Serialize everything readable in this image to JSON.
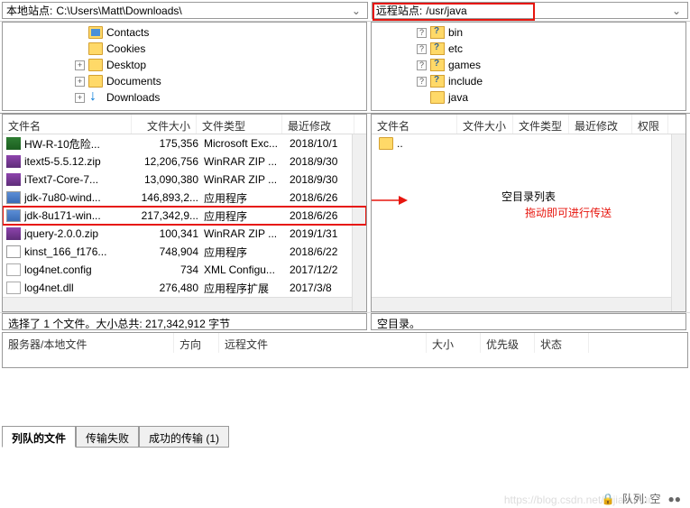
{
  "local": {
    "label": "本地站点:",
    "path": "C:\\Users\\Matt\\Downloads\\",
    "tree": [
      {
        "toggle": "",
        "icon": "contacts",
        "name": "Contacts"
      },
      {
        "toggle": "",
        "icon": "folder",
        "name": "Cookies"
      },
      {
        "toggle": "+",
        "icon": "folder",
        "name": "Desktop"
      },
      {
        "toggle": "+",
        "icon": "folder",
        "name": "Documents"
      },
      {
        "toggle": "+",
        "icon": "download",
        "name": "Downloads"
      }
    ],
    "headers": {
      "name": "文件名",
      "size": "文件大小",
      "type": "文件类型",
      "date": "最近修改"
    },
    "files": [
      {
        "icon": "xlsx",
        "name": "HW-R-10危险...",
        "size": "175,356",
        "type": "Microsoft Exc...",
        "date": "2018/10/1"
      },
      {
        "icon": "zip",
        "name": "itext5-5.5.12.zip",
        "size": "12,206,756",
        "type": "WinRAR ZIP ...",
        "date": "2018/9/30"
      },
      {
        "icon": "zip",
        "name": "iText7-Core-7...",
        "size": "13,090,380",
        "type": "WinRAR ZIP ...",
        "date": "2018/9/30"
      },
      {
        "icon": "exe-java",
        "name": "jdk-7u80-wind...",
        "size": "146,893,2...",
        "type": "应用程序",
        "date": "2018/6/26"
      },
      {
        "icon": "exe-java",
        "name": "jdk-8u171-win...",
        "size": "217,342,9...",
        "type": "应用程序",
        "date": "2018/6/26",
        "highlight": true
      },
      {
        "icon": "zip",
        "name": "jquery-2.0.0.zip",
        "size": "100,341",
        "type": "WinRAR ZIP ...",
        "date": "2019/1/31"
      },
      {
        "icon": "exe",
        "name": "kinst_166_f176...",
        "size": "748,904",
        "type": "应用程序",
        "date": "2018/6/22"
      },
      {
        "icon": "config",
        "name": "log4net.config",
        "size": "734",
        "type": "XML Configu...",
        "date": "2017/12/2"
      },
      {
        "icon": "dll",
        "name": "log4net.dll",
        "size": "276,480",
        "type": "应用程序扩展",
        "date": "2017/3/8"
      }
    ],
    "status": "选择了 1 个文件。大小总共: 217,342,912 字节"
  },
  "remote": {
    "label": "远程站点:",
    "path": "/usr/java",
    "tree": [
      {
        "toggle": "?",
        "icon": "folder-q",
        "name": "bin"
      },
      {
        "toggle": "?",
        "icon": "folder-q",
        "name": "etc"
      },
      {
        "toggle": "?",
        "icon": "folder-q",
        "name": "games"
      },
      {
        "toggle": "?",
        "icon": "folder-q",
        "name": "include"
      },
      {
        "toggle": "",
        "icon": "folder",
        "name": "java"
      }
    ],
    "headers": {
      "name": "文件名",
      "size": "文件大小",
      "type": "文件类型",
      "date": "最近修改",
      "perm": "权限"
    },
    "parent": "..",
    "empty_text": "空目录列表",
    "hint_text": "拖动即可进行传送",
    "status": "空目录。"
  },
  "queue": {
    "headers": {
      "local": "服务器/本地文件",
      "dir": "方向",
      "remote": "远程文件",
      "size": "大小",
      "prio": "优先级",
      "state": "状态"
    }
  },
  "tabs": {
    "queued": "列队的文件",
    "failed": "传输失败",
    "success": "成功的传输 (1)"
  },
  "bottom": {
    "queue_label": "队列: 空"
  },
  "watermark": "https://blog.csdn.net/tujiaouhun"
}
